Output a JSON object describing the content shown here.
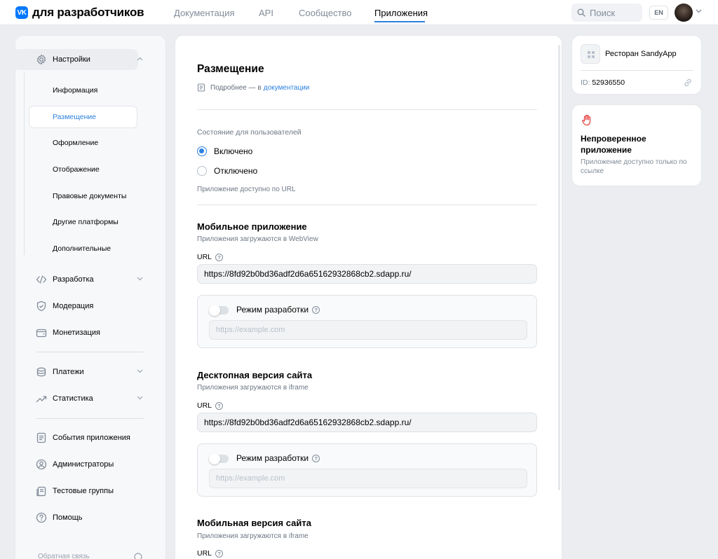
{
  "header": {
    "logo_mark": "VK",
    "logo_text": "для разработчиков",
    "nav": [
      "Документация",
      "API",
      "Сообщество",
      "Приложения"
    ],
    "search_placeholder": "Поиск",
    "lang": "EN"
  },
  "sidebar": {
    "settings": "Настройки",
    "sub": [
      "Информация",
      "Размещение",
      "Оформление",
      "Отображение",
      "Правовые документы",
      "Другие платформы",
      "Дополнительные"
    ],
    "active_sub": "Размещение",
    "group1": [
      "Разработка",
      "Модерация",
      "Монетизация"
    ],
    "group2": [
      "Платежи",
      "Статистика"
    ],
    "group3": [
      "События приложения",
      "Администраторы",
      "Тестовые группы",
      "Помощь"
    ],
    "feedback": "Обратная связь"
  },
  "main": {
    "title": "Размещение",
    "more_text": "Подробнее — в",
    "more_link": "документации",
    "state_label": "Состояние для пользователей",
    "radio_on": "Включено",
    "radio_off": "Отключено",
    "url_note": "Приложение доступно по URL",
    "sections": [
      {
        "title": "Мобильное приложение",
        "subtitle": "Приложения загружаются в WebView",
        "url_label": "URL",
        "url": "https://8fd92b0bd36adf2d6a65162932868cb2.sdapp.ru/",
        "dev_mode": "Режим разработки",
        "dev_placeholder": "https://example.com"
      },
      {
        "title": "Десктопная версия сайта",
        "subtitle": "Приложения загружаются в iframe",
        "url_label": "URL",
        "url": "https://8fd92b0bd36adf2d6a65162932868cb2.sdapp.ru/",
        "dev_mode": "Режим разработки",
        "dev_placeholder": "https://example.com"
      },
      {
        "title": "Мобильная версия сайта",
        "subtitle": "Приложения загружаются в iframe",
        "url_label": "URL"
      }
    ]
  },
  "app_card": {
    "name": "Ресторан SandyApp",
    "id_label": "ID:",
    "id": "52936550"
  },
  "status_card": {
    "title": "Непроверенное приложение",
    "subtitle": "Приложение доступно только по ссылке"
  },
  "colors": {
    "accent": "#2d81e0",
    "brand": "#0077ff",
    "warning": "#e64646"
  }
}
